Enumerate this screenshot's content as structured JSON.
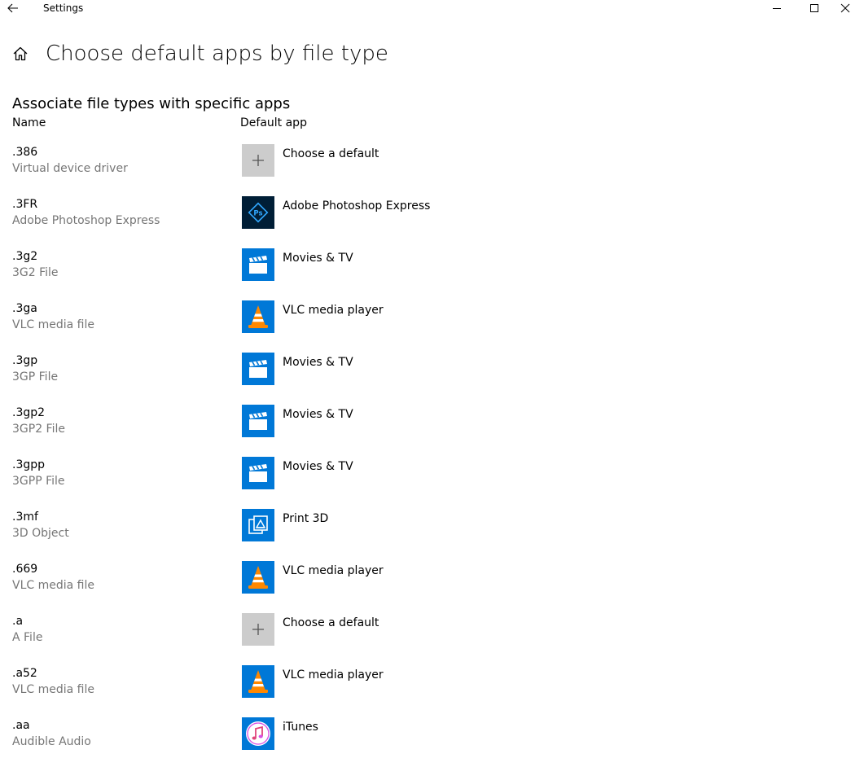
{
  "window": {
    "title": "Settings"
  },
  "header": {
    "page_title": "Choose default apps by file type"
  },
  "section": {
    "title": "Associate file types with specific apps",
    "col_name": "Name",
    "col_app": "Default app"
  },
  "rows": [
    {
      "ext": ".386",
      "desc": "Virtual device driver",
      "app": "Choose a default",
      "icon": "plus-icon"
    },
    {
      "ext": ".3FR",
      "desc": "Adobe Photoshop Express",
      "app": "Adobe Photoshop Express",
      "icon": "photoshop-express-icon"
    },
    {
      "ext": ".3g2",
      "desc": "3G2 File",
      "app": "Movies & TV",
      "icon": "movies-tv-icon"
    },
    {
      "ext": ".3ga",
      "desc": "VLC media file",
      "app": "VLC media player",
      "icon": "vlc-icon"
    },
    {
      "ext": ".3gp",
      "desc": "3GP File",
      "app": "Movies & TV",
      "icon": "movies-tv-icon"
    },
    {
      "ext": ".3gp2",
      "desc": "3GP2 File",
      "app": "Movies & TV",
      "icon": "movies-tv-icon"
    },
    {
      "ext": ".3gpp",
      "desc": "3GPP File",
      "app": "Movies & TV",
      "icon": "movies-tv-icon"
    },
    {
      "ext": ".3mf",
      "desc": "3D Object",
      "app": "Print 3D",
      "icon": "print-3d-icon"
    },
    {
      "ext": ".669",
      "desc": "VLC media file",
      "app": "VLC media player",
      "icon": "vlc-icon"
    },
    {
      "ext": ".a",
      "desc": "A File",
      "app": "Choose a default",
      "icon": "plus-icon"
    },
    {
      "ext": ".a52",
      "desc": "VLC media file",
      "app": "VLC media player",
      "icon": "vlc-icon"
    },
    {
      "ext": ".aa",
      "desc": "Audible Audio",
      "app": "iTunes",
      "icon": "itunes-icon"
    }
  ],
  "colors": {
    "accent": "#0078d7",
    "secondary_text": "#767676",
    "default_tile": "#cccccc",
    "photoshop_tile": "#001e36"
  }
}
